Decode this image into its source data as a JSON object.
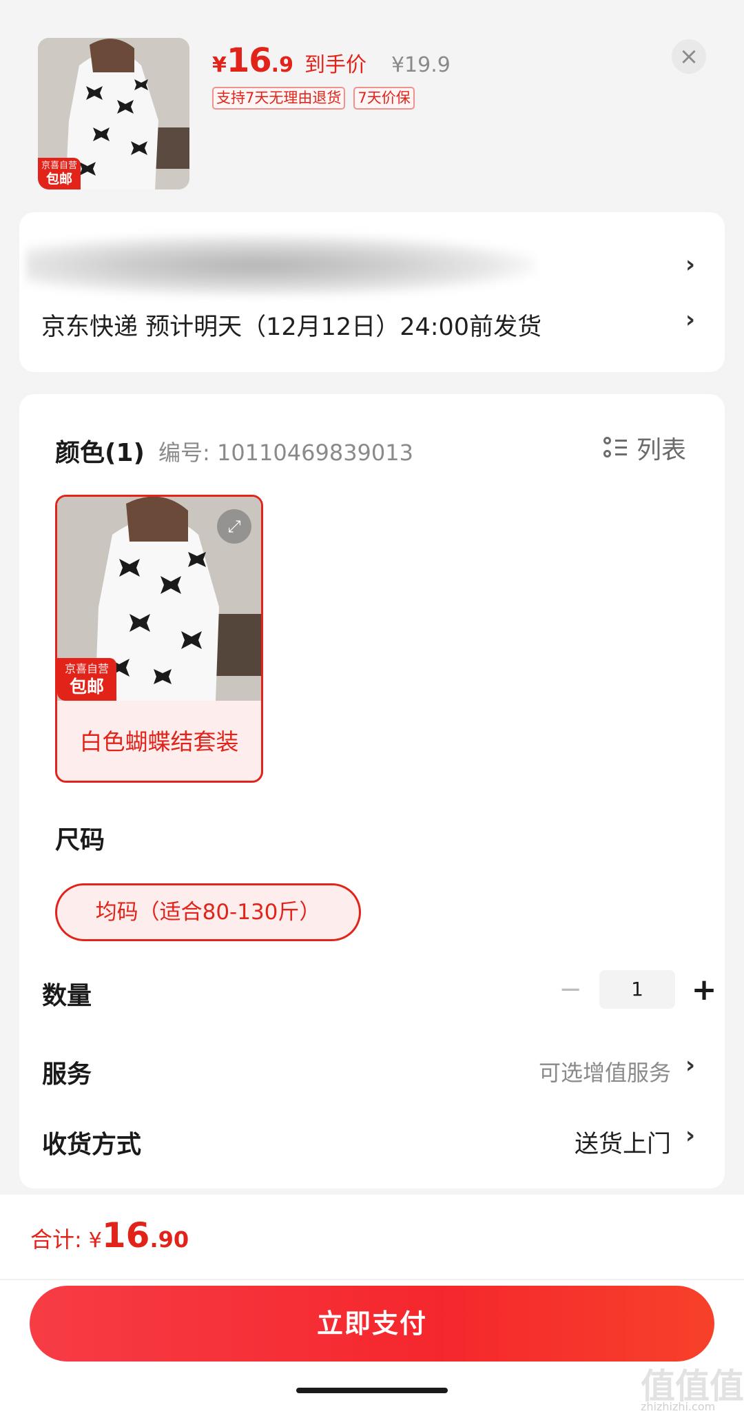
{
  "header": {
    "currency": "¥",
    "price_int": "16",
    "price_dec": ".9",
    "price_label": "到手价",
    "original_price": "¥19.9",
    "tags": [
      "支持7天无理由退货",
      "7天价保"
    ],
    "close_label": "×",
    "badge_top": "京喜自营",
    "badge_bottom": "包邮"
  },
  "address": {
    "shipping": "京东快递 预计明天（12月12日）24:00前发货"
  },
  "color_section": {
    "title": "颜色(1)",
    "sku": "编号: 10110469839013",
    "list_label": "列表",
    "option_label": "白色蝴蝶结套装",
    "badge_top": "京喜自营",
    "badge_bottom": "包邮"
  },
  "size_section": {
    "title": "尺码",
    "option_label": "均码（适合80-130斤）"
  },
  "quantity": {
    "label": "数量",
    "minus": "−",
    "value": "1",
    "plus": "+"
  },
  "service": {
    "label": "服务",
    "value": "可选增值服务"
  },
  "delivery": {
    "label": "收货方式",
    "value": "送货上门"
  },
  "chevron": "›",
  "footer": {
    "total_label": "合计:",
    "currency": "¥",
    "total_int": "16",
    "total_dec": ".90",
    "pay_label": "立即支付",
    "watermark": "值值值",
    "watermark_sub": "zhizhizhi.com"
  },
  "colors": {
    "accent": "#e2231a",
    "tag_border": "#f1918c",
    "chip_bg": "#fdeeed"
  }
}
